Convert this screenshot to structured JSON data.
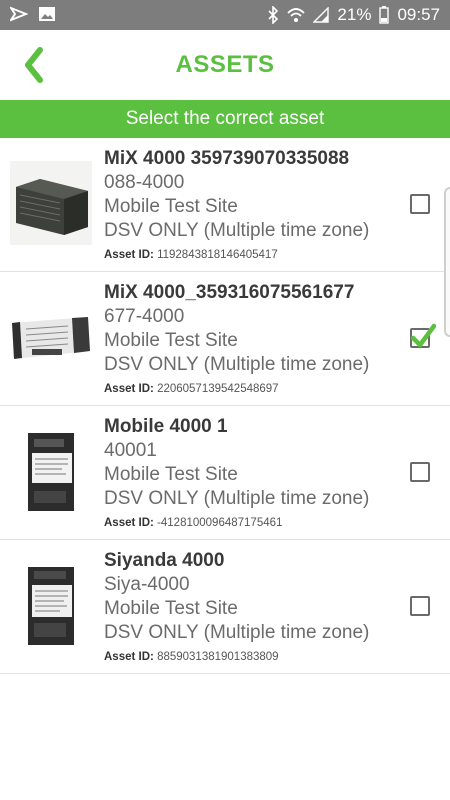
{
  "status_bar": {
    "battery_percent": "21%",
    "time": "09:57",
    "icons": [
      "navigation-icon",
      "image-icon",
      "bluetooth-icon",
      "wifi-icon",
      "signal-icon",
      "battery-icon"
    ]
  },
  "header": {
    "title": "ASSETS",
    "back_icon": "chevron-left-icon"
  },
  "banner": {
    "text": "Select the correct asset"
  },
  "colors": {
    "accent": "#5bbf3f",
    "status_bar": "#7d7d7d"
  },
  "assets": [
    {
      "name": "MiX 4000 359739070335088",
      "code": "088-4000",
      "site": "Mobile Test Site",
      "group": "DSV ONLY (Multiple time zone)",
      "asset_id_label": "Asset ID:",
      "asset_id": "1192843818146405417",
      "checked": false
    },
    {
      "name": "MiX 4000_359316075561677",
      "code": "677-4000",
      "site": "Mobile Test Site",
      "group": "DSV ONLY (Multiple time zone)",
      "asset_id_label": "Asset ID:",
      "asset_id": "2206057139542548697",
      "checked": true
    },
    {
      "name": "Mobile 4000 1",
      "code": "40001",
      "site": "Mobile Test Site",
      "group": "DSV ONLY (Multiple time zone)",
      "asset_id_label": "Asset ID:",
      "asset_id": "-4128100096487175461",
      "checked": false
    },
    {
      "name": "Siyanda 4000",
      "code": "Siya-4000",
      "site": "Mobile Test Site",
      "group": "DSV ONLY (Multiple time zone)",
      "asset_id_label": "Asset ID:",
      "asset_id": "8859031381901383809",
      "checked": false
    }
  ]
}
